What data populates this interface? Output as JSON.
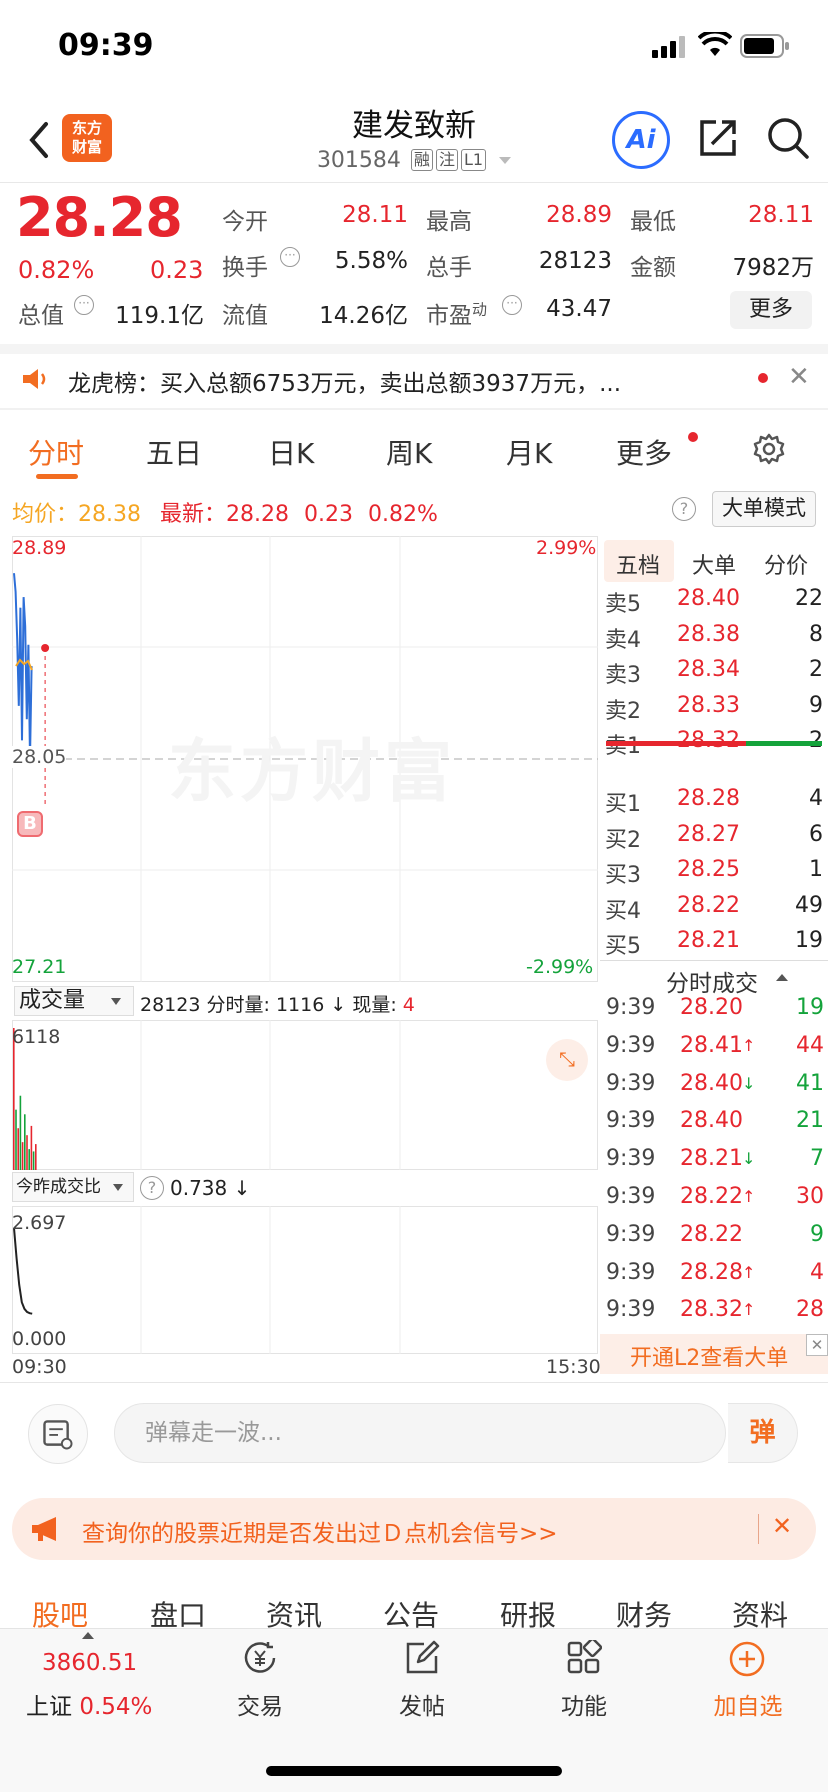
{
  "status_bar": {
    "time": "09:39"
  },
  "header": {
    "logo_line1": "东方",
    "logo_line2": "财富",
    "stock_name": "建发致新",
    "stock_code": "301584",
    "tag_margin": "融",
    "tag_follow": "注",
    "tag_level": "L1",
    "ai_label": "Ai"
  },
  "quote": {
    "price": "28.28",
    "change_pct": "0.82%",
    "change_amt": "0.23",
    "open_label": "今开",
    "open": "28.11",
    "high_label": "最高",
    "high": "28.89",
    "low_label": "最低",
    "low": "28.11",
    "turnover_label": "换手",
    "turnover": "5.58%",
    "volume_label": "总手",
    "volume": "28123",
    "amount_label": "金额",
    "amount": "7982万",
    "mktcap_label": "总值",
    "mktcap": "119.1亿",
    "float_label": "流值",
    "float": "14.26亿",
    "pe_label": "市盈",
    "pe_sup": "动",
    "pe": "43.47",
    "more_label": "更多"
  },
  "notice": {
    "text": "龙虎榜：买入总额6753万元，卖出总额3937万元，..."
  },
  "chart_tabs": [
    "分时",
    "五日",
    "日K",
    "周K",
    "月K",
    "更多"
  ],
  "info_line": {
    "avg_label": "均价：",
    "avg": "28.38",
    "latest_label": "最新：",
    "latest": "28.28",
    "latest_chg": "0.23",
    "latest_pct": "0.82%",
    "mode_btn": "大单模式"
  },
  "chart": {
    "watermark": "东方财富",
    "y_top": "28.89",
    "y_mid": "28.05",
    "y_bottom": "27.21",
    "pct_top": "2.99%",
    "pct_bottom": "-2.99%",
    "buy_marker": "B",
    "time_start": "09:30",
    "time_end": "15:30"
  },
  "chart_data": {
    "type": "line",
    "x_range": [
      "09:30",
      "15:30"
    ],
    "ylim": [
      27.21,
      28.89
    ],
    "reference": 28.05,
    "series": [
      {
        "values": [
          28.75,
          28.68,
          28.5,
          28.25,
          28.62,
          28.12,
          28.66,
          28.55,
          28.2,
          28.48,
          28.05,
          28.4
        ]
      }
    ],
    "volume_max": "6118",
    "volume": [
      6118,
      2600,
      1800,
      3200,
      1200,
      2400,
      1500,
      900,
      1900,
      800,
      1116
    ],
    "ratio_max": "2.697",
    "ratio_min": "0.000",
    "ratio": [
      2.697,
      2.0,
      1.4,
      1.0,
      0.85,
      0.78,
      0.75,
      0.738
    ]
  },
  "volume_panel": {
    "dropdown": "成交量",
    "total": "28123",
    "minute_label": "分时量:",
    "minute": "1116",
    "now_label": "现量:",
    "now": "4"
  },
  "ratio_panel": {
    "dropdown": "今昨成交比",
    "value": "0.738"
  },
  "order_book": {
    "tabs": [
      "五档",
      "大单",
      "分价"
    ],
    "asks": [
      {
        "label": "卖5",
        "price": "28.40",
        "qty": "22"
      },
      {
        "label": "卖4",
        "price": "28.38",
        "qty": "8"
      },
      {
        "label": "卖3",
        "price": "28.34",
        "qty": "2"
      },
      {
        "label": "卖2",
        "price": "28.33",
        "qty": "9"
      },
      {
        "label": "卖1",
        "price": "28.32",
        "qty": "2"
      }
    ],
    "bids": [
      {
        "label": "买1",
        "price": "28.28",
        "qty": "4"
      },
      {
        "label": "买2",
        "price": "28.27",
        "qty": "6"
      },
      {
        "label": "买3",
        "price": "28.25",
        "qty": "1"
      },
      {
        "label": "买4",
        "price": "28.22",
        "qty": "49"
      },
      {
        "label": "买5",
        "price": "28.21",
        "qty": "19"
      }
    ]
  },
  "trades": {
    "title": "分时成交",
    "rows": [
      {
        "time": "9:39",
        "price": "28.20",
        "arrow": "",
        "qty": "19",
        "qty_color": "#14a33b"
      },
      {
        "time": "9:39",
        "price": "28.41",
        "arrow": "↑",
        "qty": "44",
        "qty_color": "#e6262e"
      },
      {
        "time": "9:39",
        "price": "28.40",
        "arrow": "↓",
        "qty": "41",
        "qty_color": "#14a33b"
      },
      {
        "time": "9:39",
        "price": "28.40",
        "arrow": "",
        "qty": "21",
        "qty_color": "#14a33b"
      },
      {
        "time": "9:39",
        "price": "28.21",
        "arrow": "↓",
        "qty": "7",
        "qty_color": "#14a33b"
      },
      {
        "time": "9:39",
        "price": "28.22",
        "arrow": "↑",
        "qty": "30",
        "qty_color": "#e6262e"
      },
      {
        "time": "9:39",
        "price": "28.22",
        "arrow": "",
        "qty": "9",
        "qty_color": "#14a33b"
      },
      {
        "time": "9:39",
        "price": "28.28",
        "arrow": "↑",
        "qty": "4",
        "qty_color": "#e6262e"
      },
      {
        "time": "9:39",
        "price": "28.32",
        "arrow": "↑",
        "qty": "28",
        "qty_color": "#e6262e"
      }
    ],
    "l2_promo": "开通L2查看大单"
  },
  "comment": {
    "placeholder": "弹幕走一波...",
    "danmu_btn": "弹"
  },
  "promo": {
    "text": "查询你的股票近期是否发出过Ｄ点机会信号>>"
  },
  "bottom_tabs": [
    "股吧",
    "盘口",
    "资讯",
    "公告",
    "研报",
    "财务",
    "资料"
  ],
  "bottom_bar": {
    "index_value": "3860.51",
    "index_name": "上证",
    "index_pct": "0.54%",
    "trade": "交易",
    "post": "发帖",
    "functions": "功能",
    "add_watch": "加自选"
  },
  "colors": {
    "up": "#e6262e",
    "down": "#14a33b",
    "accent": "#f26d21",
    "avg_line": "#f5a623",
    "price_line": "#2e6fd8"
  }
}
